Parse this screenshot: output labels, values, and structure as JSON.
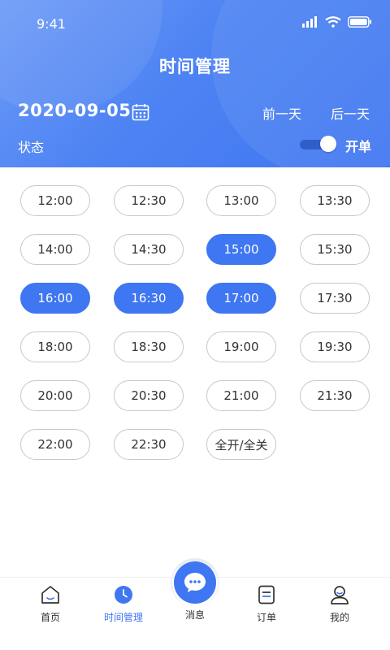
{
  "status_bar": {
    "time": "9:41"
  },
  "header": {
    "title": "时间管理",
    "date": "2020-09-05",
    "prev_day": "前一天",
    "next_day": "后一天",
    "status_label": "状态",
    "toggle_on": true,
    "toggle_label": "开单"
  },
  "slots": [
    {
      "label": "12:00",
      "selected": false
    },
    {
      "label": "12:30",
      "selected": false
    },
    {
      "label": "13:00",
      "selected": false
    },
    {
      "label": "13:30",
      "selected": false
    },
    {
      "label": "14:00",
      "selected": false
    },
    {
      "label": "14:30",
      "selected": false
    },
    {
      "label": "15:00",
      "selected": true
    },
    {
      "label": "15:30",
      "selected": false
    },
    {
      "label": "16:00",
      "selected": true
    },
    {
      "label": "16:30",
      "selected": true
    },
    {
      "label": "17:00",
      "selected": true
    },
    {
      "label": "17:30",
      "selected": false
    },
    {
      "label": "18:00",
      "selected": false
    },
    {
      "label": "18:30",
      "selected": false
    },
    {
      "label": "19:00",
      "selected": false
    },
    {
      "label": "19:30",
      "selected": false
    },
    {
      "label": "20:00",
      "selected": false
    },
    {
      "label": "20:30",
      "selected": false
    },
    {
      "label": "21:00",
      "selected": false
    },
    {
      "label": "21:30",
      "selected": false
    },
    {
      "label": "22:00",
      "selected": false
    },
    {
      "label": "22:30",
      "selected": false
    },
    {
      "label": "全开/全关",
      "selected": false
    }
  ],
  "tabbar": {
    "home": "首页",
    "time": "时间管理",
    "messages": "消息",
    "orders": "订单",
    "mine": "我的"
  },
  "colors": {
    "accent": "#3f76f1",
    "header_start": "#6d9bf7",
    "slot_border": "#c8c8c8"
  },
  "icons": {
    "calendar": "calendar-icon",
    "home": "home-icon",
    "time": "clock-icon",
    "messages": "chat-bubble-icon",
    "orders": "order-list-icon",
    "mine": "user-icon"
  }
}
